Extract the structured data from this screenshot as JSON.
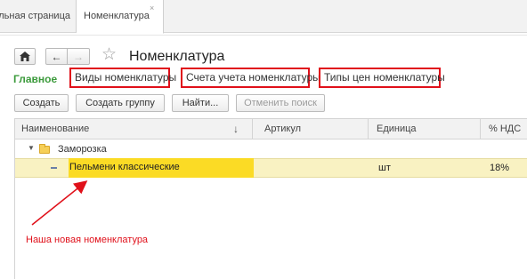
{
  "tabs": {
    "home": "Начальная страница",
    "active": "Номенклатура",
    "close": "×"
  },
  "nav": {
    "home_icon": "home-icon",
    "back": "←",
    "forward": "→",
    "star": "☆",
    "title": "Номенклатура"
  },
  "links": {
    "main": "Главное",
    "item1": "Виды номенклатуры",
    "item2": "Счета учета номенклатуры",
    "item3": "Типы цен номенклатуры"
  },
  "commands": {
    "create": "Создать",
    "create_group": "Создать группу",
    "find": "Найти...",
    "cancel_search": "Отменить поиск"
  },
  "table": {
    "columns": [
      "Наименование",
      "Артикул",
      "Единица",
      "% НДС"
    ],
    "sort_icon": "↓",
    "group": "Заморозка",
    "rows": [
      {
        "name": "Пельмени классические",
        "article": "",
        "unit": "шт",
        "vat": "18%"
      }
    ]
  },
  "annotation": "Наша новая номенклатура",
  "colors": {
    "highlight_border": "#e0101a",
    "selected_cell": "#fbdb25",
    "selected_row": "#f9f2c2",
    "main_link": "#3b9a3b"
  }
}
